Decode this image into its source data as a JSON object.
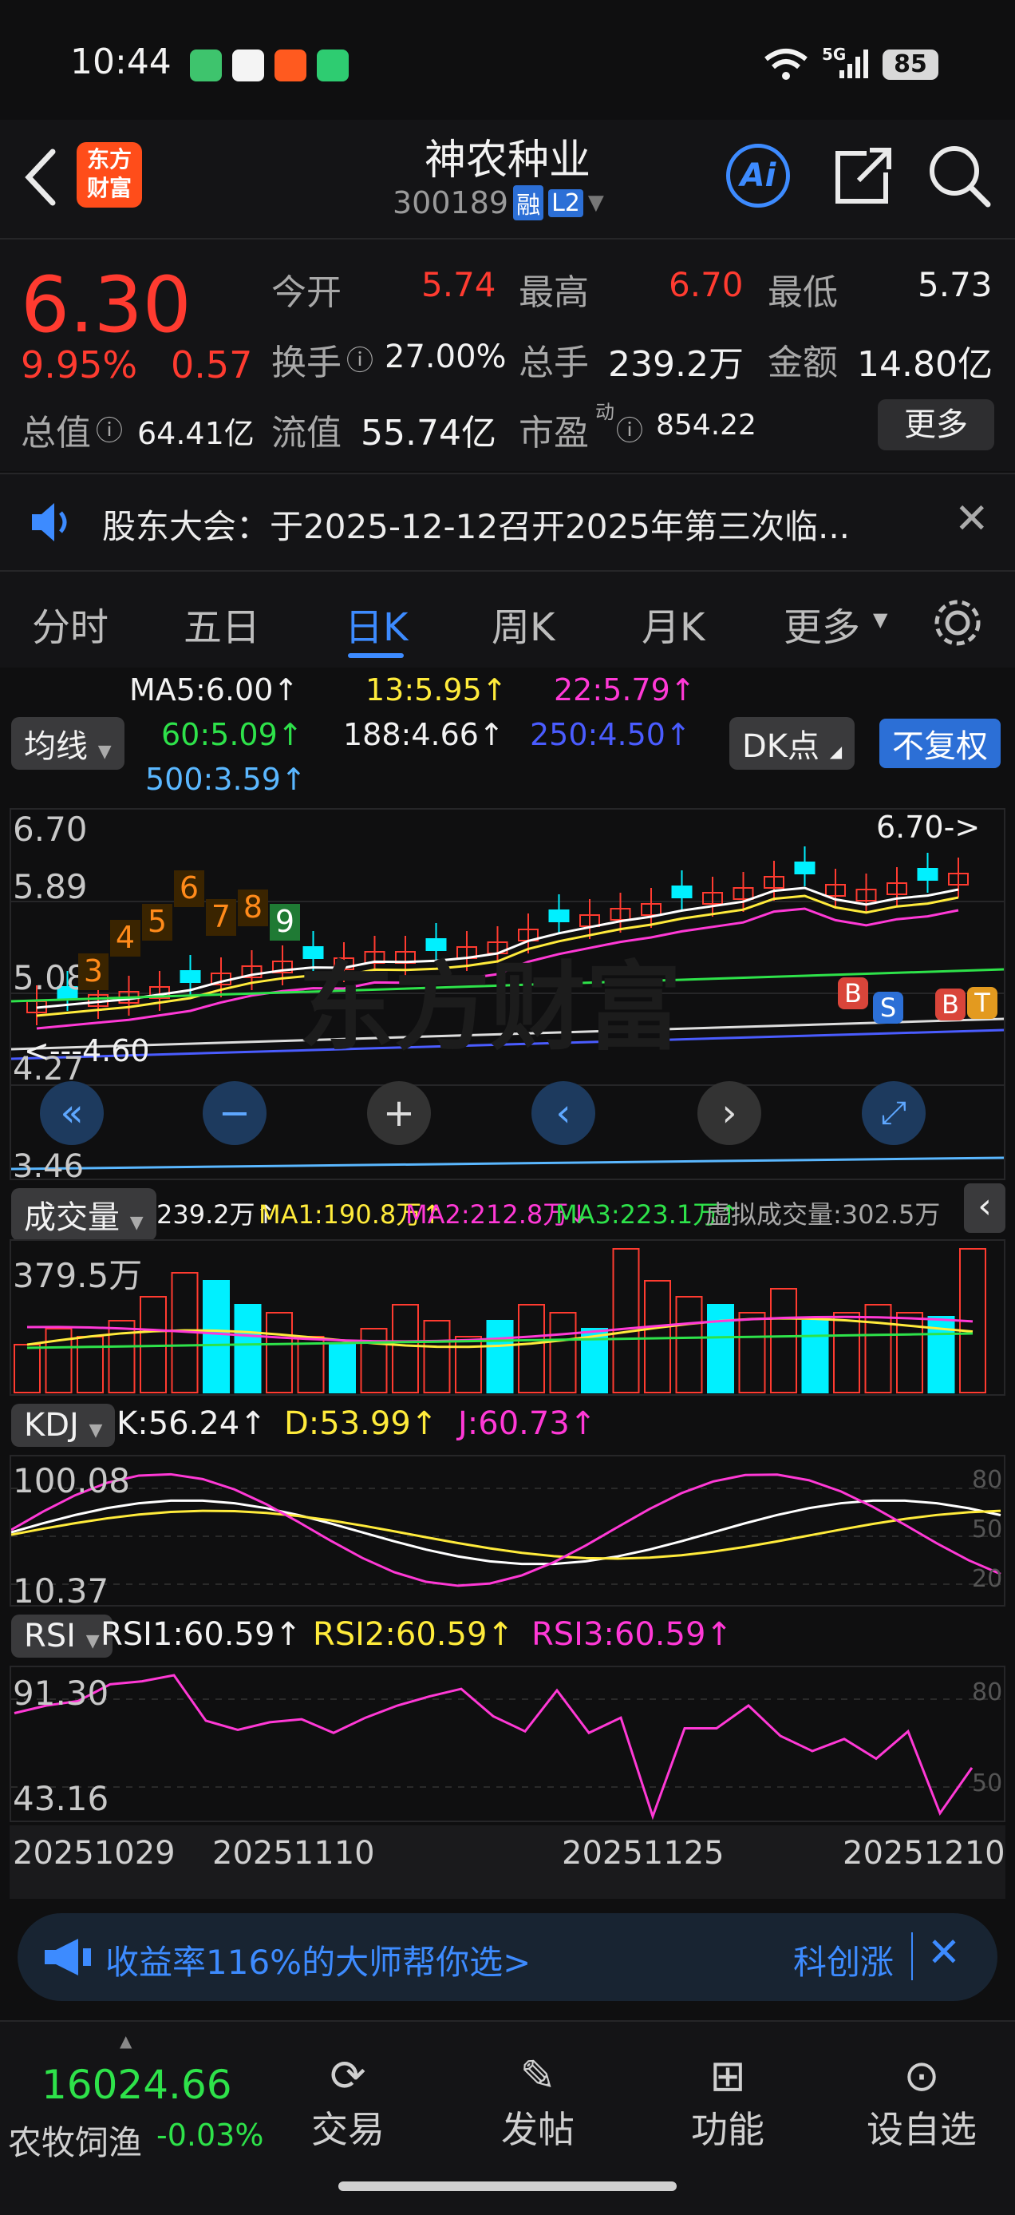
{
  "status": {
    "time": "10:44",
    "network": "5G",
    "battery": "85"
  },
  "header": {
    "title": "神农种业",
    "code": "300189",
    "badge_rong": "融",
    "badge_l2": "L2",
    "logo_line1": "东方",
    "logo_line2": "财富",
    "ai_label": "Ai"
  },
  "quote": {
    "price": "6.30",
    "pct": "9.95%",
    "chg": "0.57",
    "open_label": "今开",
    "open": "5.74",
    "high_label": "最高",
    "high": "6.70",
    "low_label": "最低",
    "low": "5.73",
    "turnover_label": "换手",
    "turnover": "27.00%",
    "volume_label": "总手",
    "volume": "239.2万",
    "amount_label": "金额",
    "amount": "14.80亿",
    "mktcap_label": "总值",
    "mktcap": "64.41亿",
    "float_label": "流值",
    "float": "55.74亿",
    "pe_label": "市盈",
    "pe_sup": "动",
    "pe": "854.22",
    "more_label": "更多"
  },
  "notice": {
    "text": "股东大会：于2025-12-12召开2025年第三次临..."
  },
  "tabs": [
    {
      "label": "分时"
    },
    {
      "label": "五日"
    },
    {
      "label": "日K"
    },
    {
      "label": "周K"
    },
    {
      "label": "月K"
    },
    {
      "label": "更多"
    }
  ],
  "ma": {
    "selector": "均线",
    "ma5": "MA5:6.00↑",
    "ma13": "13:5.95↑",
    "ma22": "22:5.79↑",
    "ma60": "60:5.09↑",
    "ma188": "188:4.66↑",
    "ma250": "250:4.50↑",
    "ma500": "500:3.59↑",
    "dk": "DK点",
    "fuquan": "不复权"
  },
  "kline": {
    "y_top": "6.70",
    "y_2": "5.89",
    "y_3": "5.08",
    "y_4": "4.27",
    "y_5": "3.46",
    "high_marker": "6.70->",
    "low_marker": "<---4.60",
    "td_counts": [
      "3",
      "4",
      "5",
      "6",
      "7",
      "8",
      "9"
    ],
    "signals": [
      "B",
      "S",
      "B",
      "T"
    ],
    "watermark": "东方财富"
  },
  "volume": {
    "selector": "成交量",
    "v": "239.2万↑",
    "ma1": "MA1:190.8万↑",
    "ma2": "MA2:212.8万↓",
    "ma3": "MA3:223.1万↑",
    "virtual": "虚拟成交量:302.5万",
    "y_top": "379.5万"
  },
  "kdj": {
    "selector": "KDJ",
    "k": "K:56.24↑",
    "d": "D:53.99↑",
    "j": "J:60.73↑",
    "y_top": "100.08",
    "y_bot": "10.37",
    "r80": "80",
    "r50": "50",
    "r20": "20"
  },
  "rsi": {
    "selector": "RSI",
    "r1": "RSI1:60.59↑",
    "r2": "RSI2:60.59↑",
    "r3": "RSI3:60.59↑",
    "y_top": "91.30",
    "y_bot": "43.16",
    "r80": "80",
    "r50": "50"
  },
  "dates": [
    "20251029",
    "20251110",
    "20251125",
    "20251210"
  ],
  "ad": {
    "text": "收益率116%的大师帮你选>",
    "right": "科创涨"
  },
  "bottom": {
    "index_value": "16024.66",
    "index_name": "农牧饲渔",
    "index_pct": "-0.03%",
    "items": [
      {
        "label": "交易"
      },
      {
        "label": "发帖"
      },
      {
        "label": "功能"
      },
      {
        "label": "设自选"
      }
    ]
  },
  "colors": {
    "up": "#ff3b30",
    "down": "#00f0ff",
    "accent": "#3d8bff",
    "bg": "#0f0f10"
  }
}
